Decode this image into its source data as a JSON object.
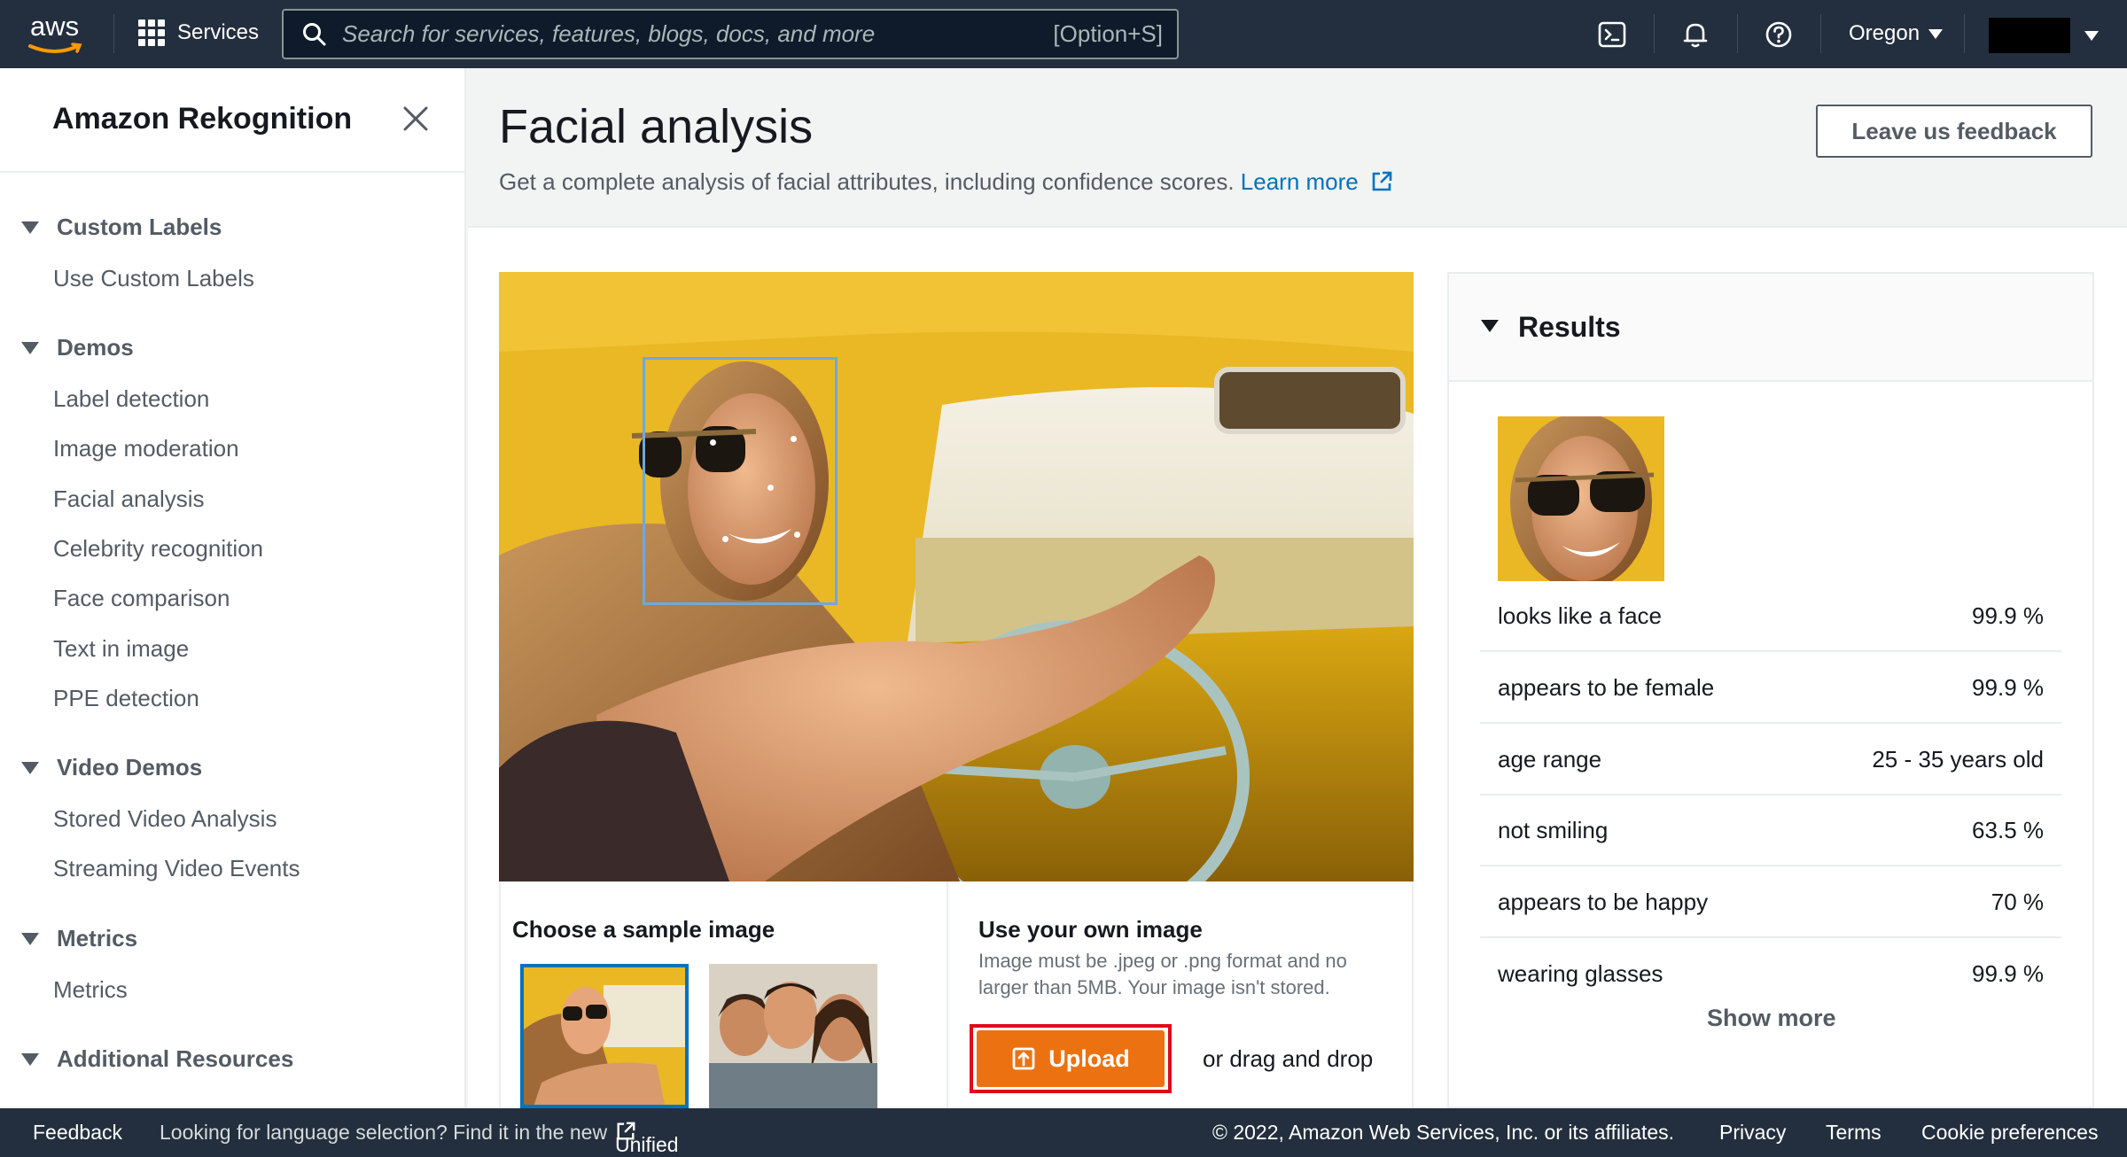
{
  "topnav": {
    "logo_text": "aws",
    "services_label": "Services",
    "search_placeholder": "Search for services, features, blogs, docs, and more",
    "search_shortcut": "[Option+S]",
    "icons": [
      "cloudshell-icon",
      "bell-icon",
      "help-icon"
    ],
    "region_label": "Oregon"
  },
  "sidebar": {
    "title": "Amazon Rekognition",
    "sections": [
      {
        "label": "Custom Labels",
        "items": [
          "Use Custom Labels"
        ]
      },
      {
        "label": "Demos",
        "items": [
          "Label detection",
          "Image moderation",
          "Facial analysis",
          "Celebrity recognition",
          "Face comparison",
          "Text in image",
          "PPE detection"
        ]
      },
      {
        "label": "Video Demos",
        "items": [
          "Stored Video Analysis",
          "Streaming Video Events"
        ]
      },
      {
        "label": "Metrics",
        "items": [
          "Metrics"
        ]
      },
      {
        "label": "Additional Resources",
        "items": []
      }
    ]
  },
  "main": {
    "title": "Facial analysis",
    "description": "Get a complete analysis of facial attributes, including confidence scores.",
    "learn_more": "Learn more",
    "feedback_button": "Leave us feedback",
    "choose_sample_title": "Choose a sample image",
    "own_image_title": "Use your own image",
    "own_image_desc": "Image must be .jpeg or .png format and no larger than 5MB. Your image isn't stored.",
    "upload_label": "Upload",
    "drag_drop": "or drag and drop"
  },
  "results": {
    "title": "Results",
    "rows": [
      {
        "label": "looks like a face",
        "value": "99.9 %"
      },
      {
        "label": "appears to be female",
        "value": "99.9 %"
      },
      {
        "label": "age range",
        "value": "25 - 35 years old"
      },
      {
        "label": "not smiling",
        "value": "63.5 %"
      },
      {
        "label": "appears to be happy",
        "value": "70 %"
      },
      {
        "label": "wearing glasses",
        "value": "99.9 %"
      }
    ],
    "show_more": "Show more"
  },
  "footer": {
    "feedback": "Feedback",
    "language_prompt": "Looking for language selection? Find it in the new",
    "unified_settings": "Unified Settings",
    "copyright": "© 2022, Amazon Web Services, Inc. or its affiliates.",
    "privacy": "Privacy",
    "terms": "Terms",
    "cookie": "Cookie preferences"
  },
  "colors": {
    "nav_bg": "#232f3e",
    "link": "#0073bb",
    "upload": "#ec7211",
    "highlight": "#e0071b"
  }
}
